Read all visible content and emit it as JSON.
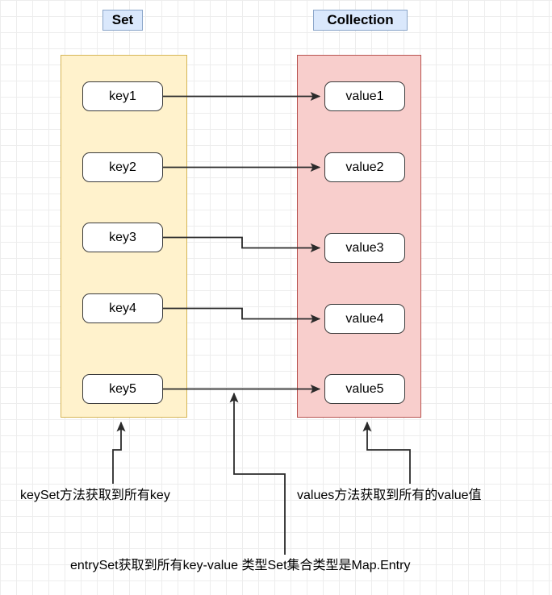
{
  "diagram": {
    "title_chips": [
      {
        "name": "set",
        "label": "Set"
      },
      {
        "name": "collection",
        "label": "Collection"
      }
    ],
    "containers": [
      {
        "name": "set-container",
        "fill": "#fff2cc",
        "stroke": "#d6b656"
      },
      {
        "name": "collection-container",
        "fill": "#f8cecc",
        "stroke": "#b85450"
      }
    ],
    "keys": [
      {
        "label": "key1"
      },
      {
        "label": "key2"
      },
      {
        "label": "key3"
      },
      {
        "label": "key4"
      },
      {
        "label": "key5"
      }
    ],
    "values": [
      {
        "label": "value1"
      },
      {
        "label": "value2"
      },
      {
        "label": "value3"
      },
      {
        "label": "value4"
      },
      {
        "label": "value5"
      }
    ],
    "captions": {
      "keyset": "keySet方法获取到所有key",
      "values": "values方法获取到所有的value值",
      "entryset": "entrySet获取到所有key-value 类型Set集合类型是Map.Entry"
    },
    "colors": {
      "chip_fill": "#dae8fc",
      "chip_stroke": "#8aa5c9",
      "set_fill": "#fff2cc",
      "set_stroke": "#d6b656",
      "collection_fill": "#f8cecc",
      "collection_stroke": "#b85450",
      "box_fill": "#ffffff",
      "box_stroke": "#3b3b3b",
      "connector": "#2b2b2b",
      "grid_minor": "#ededed",
      "grid_major": "#d9d9d9",
      "canvas": "#ffffff"
    }
  }
}
